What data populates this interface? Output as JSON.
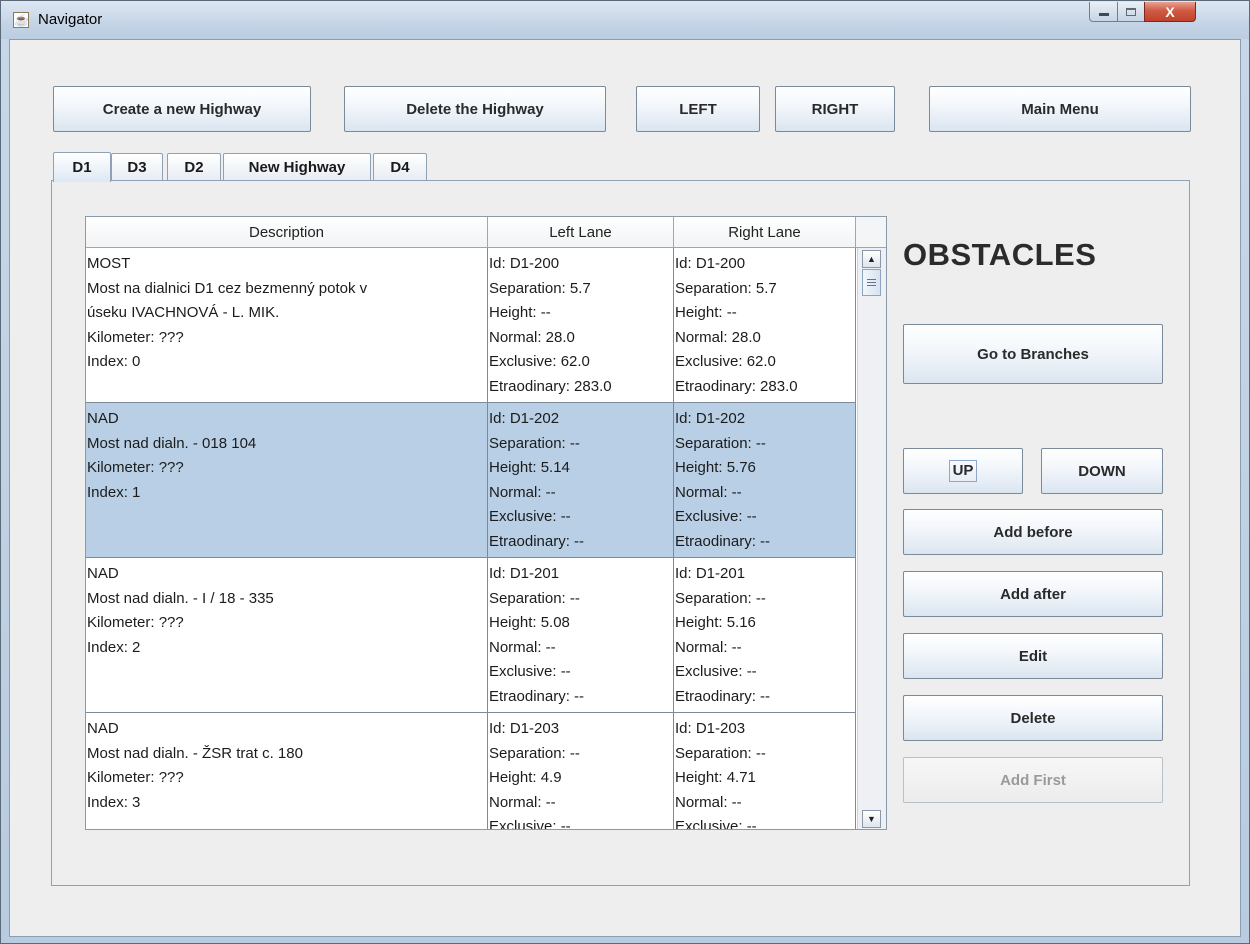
{
  "window": {
    "title": "Navigator",
    "app_icon": "java-cup-icon",
    "controls": {
      "minimize": "minimize-icon",
      "maximize": "maximize-icon",
      "close": "close-icon",
      "close_glyph": "X"
    }
  },
  "toolbar": {
    "create_label": "Create a new Highway",
    "delete_label": "Delete the Highway",
    "left_label": "LEFT",
    "right_label": "RIGHT",
    "main_menu_label": "Main Menu"
  },
  "tabs": [
    {
      "label": "D1",
      "active": true
    },
    {
      "label": "D3"
    },
    {
      "label": "D2"
    },
    {
      "label": "New Highway"
    },
    {
      "label": "D4"
    }
  ],
  "table": {
    "columns": [
      "Description",
      "Left Lane",
      "Right Lane"
    ],
    "rows": [
      {
        "selected": false,
        "description": [
          "MOST",
          "Most na dialnici D1 cez bezmenný potok v",
          "úseku IVACHNOVÁ - L. MIK.",
          "Kilometer: ???",
          "Index: 0"
        ],
        "left": [
          "Id: D1-200",
          "Separation: 5.7",
          "Height: --",
          "Normal: 28.0",
          "Exclusive: 62.0",
          "Etraodinary: 283.0"
        ],
        "right": [
          "Id: D1-200",
          "Separation: 5.7",
          "Height: --",
          "Normal: 28.0",
          "Exclusive: 62.0",
          "Etraodinary: 283.0"
        ]
      },
      {
        "selected": true,
        "description": [
          "NAD",
          "Most nad dialn. - 018 104",
          "Kilometer: ???",
          "Index: 1"
        ],
        "left": [
          "Id: D1-202",
          "Separation: --",
          "Height: 5.14",
          "Normal: --",
          "Exclusive: --",
          "Etraodinary: --"
        ],
        "right": [
          "Id: D1-202",
          "Separation: --",
          "Height: 5.76",
          "Normal: --",
          "Exclusive: --",
          "Etraodinary: --"
        ]
      },
      {
        "selected": false,
        "description": [
          "NAD",
          "Most nad dialn. - I / 18 - 335",
          "Kilometer: ???",
          "Index: 2"
        ],
        "left": [
          "Id: D1-201",
          "Separation: --",
          "Height: 5.08",
          "Normal: --",
          "Exclusive: --",
          "Etraodinary: --"
        ],
        "right": [
          "Id: D1-201",
          "Separation: --",
          "Height: 5.16",
          "Normal: --",
          "Exclusive: --",
          "Etraodinary: --"
        ]
      },
      {
        "selected": false,
        "description": [
          "NAD",
          "Most nad dialn. - ŽSR trat c. 180",
          "Kilometer: ???",
          "Index: 3"
        ],
        "left": [
          "Id: D1-203",
          "Separation: --",
          "Height: 4.9",
          "Normal: --",
          "Exclusive: --"
        ],
        "right": [
          "Id: D1-203",
          "Separation: --",
          "Height: 4.71",
          "Normal: --",
          "Exclusive: --"
        ]
      }
    ]
  },
  "scrollbar": {
    "up_icon": "scroll-up-arrow-icon",
    "down_icon": "scroll-down-arrow-icon"
  },
  "side": {
    "heading": "OBSTACLES",
    "go_to_branches_label": "Go to Branches",
    "up_label": "UP",
    "down_label": "DOWN",
    "add_before_label": "Add before",
    "add_after_label": "Add after",
    "edit_label": "Edit",
    "delete_label": "Delete",
    "add_first_label": "Add First",
    "add_first_enabled": false
  }
}
